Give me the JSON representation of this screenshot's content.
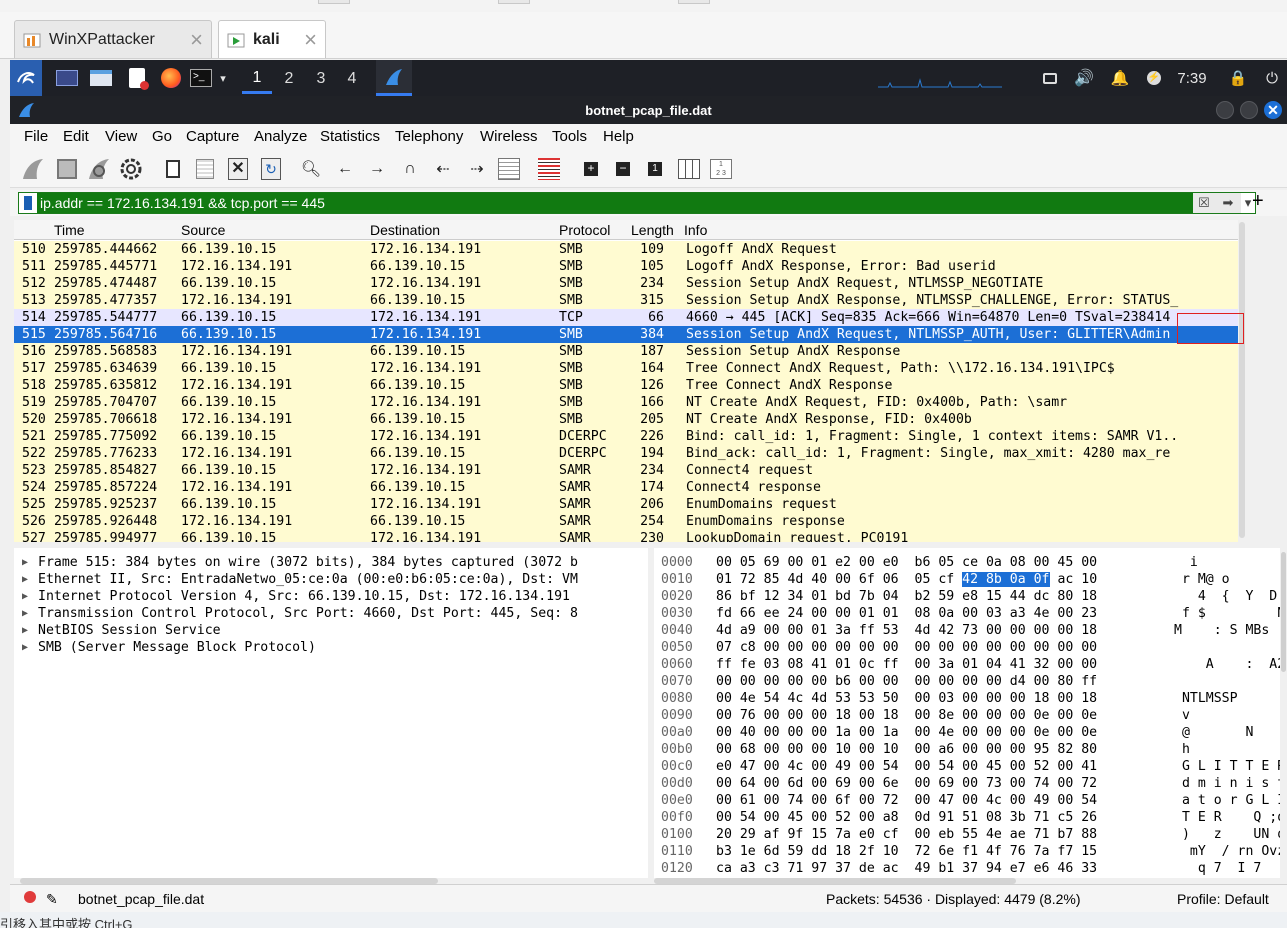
{
  "host": {
    "tabs": [
      {
        "label": "WinXPattacker",
        "active": false
      },
      {
        "label": "kali",
        "active": true
      }
    ],
    "bottom_text": "引移入其中或按 Ctrl+G"
  },
  "panel": {
    "workspaces": [
      "1",
      "2",
      "3",
      "4"
    ],
    "active_workspace": "1",
    "clock": "7:39"
  },
  "window": {
    "title": "botnet_pcap_file.dat"
  },
  "menu": [
    "File",
    "Edit",
    "View",
    "Go",
    "Capture",
    "Analyze",
    "Statistics",
    "Telephony",
    "Wireless",
    "Tools",
    "Help"
  ],
  "filter": {
    "value": "ip.addr == 172.16.134.191 && tcp.port == 445"
  },
  "packet_list": {
    "headers": {
      "no": "No.",
      "time": "Time",
      "source": "Source",
      "destination": "Destination",
      "protocol": "Protocol",
      "length": "Length",
      "info": "Info"
    },
    "rows": [
      {
        "no": "510",
        "time": "259785.444662",
        "src": "66.139.10.15",
        "dst": "172.16.134.191",
        "proto": "SMB",
        "len": "109",
        "info": "Logoff AndX Request",
        "kind": "smb"
      },
      {
        "no": "511",
        "time": "259785.445771",
        "src": "172.16.134.191",
        "dst": "66.139.10.15",
        "proto": "SMB",
        "len": "105",
        "info": "Logoff AndX Response, Error: Bad userid",
        "kind": "smb"
      },
      {
        "no": "512",
        "time": "259785.474487",
        "src": "66.139.10.15",
        "dst": "172.16.134.191",
        "proto": "SMB",
        "len": "234",
        "info": "Session Setup AndX Request, NTLMSSP_NEGOTIATE",
        "kind": "smb"
      },
      {
        "no": "513",
        "time": "259785.477357",
        "src": "172.16.134.191",
        "dst": "66.139.10.15",
        "proto": "SMB",
        "len": "315",
        "info": "Session Setup AndX Response, NTLMSSP_CHALLENGE, Error: STATUS_",
        "kind": "smb"
      },
      {
        "no": "514",
        "time": "259785.544777",
        "src": "66.139.10.15",
        "dst": "172.16.134.191",
        "proto": "TCP",
        "len": "66",
        "info": "4660 → 445 [ACK] Seq=835 Ack=666 Win=64870 Len=0 TSval=238414",
        "kind": "tcp"
      },
      {
        "no": "515",
        "time": "259785.564716",
        "src": "66.139.10.15",
        "dst": "172.16.134.191",
        "proto": "SMB",
        "len": "384",
        "info": "Session Setup AndX Request, NTLMSSP_AUTH, User: GLITTER\\Admin",
        "kind": "sel"
      },
      {
        "no": "516",
        "time": "259785.568583",
        "src": "172.16.134.191",
        "dst": "66.139.10.15",
        "proto": "SMB",
        "len": "187",
        "info": "Session Setup AndX Response",
        "kind": "smb"
      },
      {
        "no": "517",
        "time": "259785.634639",
        "src": "66.139.10.15",
        "dst": "172.16.134.191",
        "proto": "SMB",
        "len": "164",
        "info": "Tree Connect AndX Request, Path: \\\\172.16.134.191\\IPC$",
        "kind": "smb"
      },
      {
        "no": "518",
        "time": "259785.635812",
        "src": "172.16.134.191",
        "dst": "66.139.10.15",
        "proto": "SMB",
        "len": "126",
        "info": "Tree Connect AndX Response",
        "kind": "smb"
      },
      {
        "no": "519",
        "time": "259785.704707",
        "src": "66.139.10.15",
        "dst": "172.16.134.191",
        "proto": "SMB",
        "len": "166",
        "info": "NT Create AndX Request, FID: 0x400b, Path: \\samr",
        "kind": "smb"
      },
      {
        "no": "520",
        "time": "259785.706618",
        "src": "172.16.134.191",
        "dst": "66.139.10.15",
        "proto": "SMB",
        "len": "205",
        "info": "NT Create AndX Response, FID: 0x400b",
        "kind": "smb"
      },
      {
        "no": "521",
        "time": "259785.775092",
        "src": "66.139.10.15",
        "dst": "172.16.134.191",
        "proto": "DCERPC",
        "len": "226",
        "info": "Bind: call_id: 1, Fragment: Single, 1 context items: SAMR V1..",
        "kind": "dce"
      },
      {
        "no": "522",
        "time": "259785.776233",
        "src": "172.16.134.191",
        "dst": "66.139.10.15",
        "proto": "DCERPC",
        "len": "194",
        "info": "Bind_ack: call_id: 1, Fragment: Single, max_xmit: 4280 max_re",
        "kind": "dce"
      },
      {
        "no": "523",
        "time": "259785.854827",
        "src": "66.139.10.15",
        "dst": "172.16.134.191",
        "proto": "SAMR",
        "len": "234",
        "info": "Connect4 request",
        "kind": "smb"
      },
      {
        "no": "524",
        "time": "259785.857224",
        "src": "172.16.134.191",
        "dst": "66.139.10.15",
        "proto": "SAMR",
        "len": "174",
        "info": "Connect4 response",
        "kind": "smb"
      },
      {
        "no": "525",
        "time": "259785.925237",
        "src": "66.139.10.15",
        "dst": "172.16.134.191",
        "proto": "SAMR",
        "len": "206",
        "info": "EnumDomains request",
        "kind": "smb"
      },
      {
        "no": "526",
        "time": "259785.926448",
        "src": "172.16.134.191",
        "dst": "66.139.10.15",
        "proto": "SAMR",
        "len": "254",
        "info": "EnumDomains response",
        "kind": "smb"
      },
      {
        "no": "527",
        "time": "259785.994977",
        "src": "66.139.10.15",
        "dst": "172.16.134.191",
        "proto": "SAMR",
        "len": "230",
        "info": "LookupDomain request, PC0191",
        "kind": "smb"
      }
    ]
  },
  "details": [
    "Frame 515: 384 bytes on wire (3072 bits), 384 bytes captured (3072 b",
    "Ethernet II, Src: EntradaNetwo_05:ce:0a (00:e0:b6:05:ce:0a), Dst: VM",
    "Internet Protocol Version 4, Src: 66.139.10.15, Dst: 172.16.134.191",
    "Transmission Control Protocol, Src Port: 4660, Dst Port: 445, Seq: 8",
    "NetBIOS Session Service",
    "SMB (Server Message Block Protocol)"
  ],
  "hex": [
    {
      "off": "0000",
      "a": "00 05 69 00 01 e2 00 e0",
      "b": "b6 05 ce 0a 08 00 45 00",
      "ascii": "  i           E "
    },
    {
      "off": "0010",
      "a": "01 72 85 4d 40 00 6f 06",
      "b": "05 cf 42 8b 0a 0f ac 10",
      "ascii": " r M@ o        ",
      "hl": "42 8b 0a 0f"
    },
    {
      "off": "0020",
      "a": "86 bf 12 34 01 bd 7b 04",
      "b": "b2 59 e8 15 44 dc 80 18",
      "ascii": "   4  {  Y  D   "
    },
    {
      "off": "0030",
      "a": "fd 66 ee 24 00 00 01 01",
      "b": "08 0a 00 03 a3 4e 00 23",
      "ascii": " f $         N #"
    },
    {
      "off": "0040",
      "a": "4d a9 00 00 01 3a ff 53",
      "b": "4d 42 73 00 00 00 00 18",
      "ascii": "M    : S MBs    "
    },
    {
      "off": "0050",
      "a": "07 c8 00 00 00 00 00 00",
      "b": "00 00 00 00 00 00 00 00",
      "ascii": "                "
    },
    {
      "off": "0060",
      "a": "ff fe 03 08 41 01 0c ff",
      "b": "00 3a 01 04 41 32 00 00",
      "ascii": "    A    :  A2  "
    },
    {
      "off": "0070",
      "a": "00 00 00 00 00 b6 00 00",
      "b": "00 00 00 00 d4 00 80 ff",
      "ascii": "                "
    },
    {
      "off": "0080",
      "a": "00 4e 54 4c 4d 53 53 50",
      "b": "00 03 00 00 00 18 00 18",
      "ascii": " NTLMSSP        "
    },
    {
      "off": "0090",
      "a": "00 76 00 00 00 18 00 18",
      "b": "00 8e 00 00 00 0e 00 0e",
      "ascii": " v              "
    },
    {
      "off": "00a0",
      "a": "00 40 00 00 00 1a 00 1a",
      "b": "00 4e 00 00 00 0e 00 0e",
      "ascii": " @       N      "
    },
    {
      "off": "00b0",
      "a": "00 68 00 00 00 10 00 10",
      "b": "00 a6 00 00 00 95 82 80",
      "ascii": " h              "
    },
    {
      "off": "00c0",
      "a": "e0 47 00 4c 00 49 00 54",
      "b": "00 54 00 45 00 52 00 41",
      "ascii": " G L I T T E R A"
    },
    {
      "off": "00d0",
      "a": "00 64 00 6d 00 69 00 6e",
      "b": "00 69 00 73 00 74 00 72",
      "ascii": " d m i n i s t r"
    },
    {
      "off": "00e0",
      "a": "00 61 00 74 00 6f 00 72",
      "b": "00 47 00 4c 00 49 00 54",
      "ascii": " a t o r G L I T"
    },
    {
      "off": "00f0",
      "a": "00 54 00 45 00 52 00 a8",
      "b": "0d 91 51 08 3b 71 c5 26",
      "ascii": " T E R    Q ;q &"
    },
    {
      "off": "0100",
      "a": "20 29 af 9f 15 7a e0 cf",
      "b": "00 eb 55 4e ae 71 b7 88",
      "ascii": " )   z    UN q  "
    },
    {
      "off": "0110",
      "a": "b3 1e 6d 59 dd 18 2f 10",
      "b": "72 6e f1 4f 76 7a f7 15",
      "ascii": "  mY  / rn Ovz  "
    },
    {
      "off": "0120",
      "a": "ca a3 c3 71 97 37 de ac",
      "b": "49 b1 37 94 e7 e6 46 33",
      "ascii": "   q 7  I 7   F3"
    }
  ],
  "status": {
    "file": "botnet_pcap_file.dat",
    "packets": "Packets: 54536 · Displayed: 4479 (8.2%)",
    "profile": "Profile: Default"
  }
}
